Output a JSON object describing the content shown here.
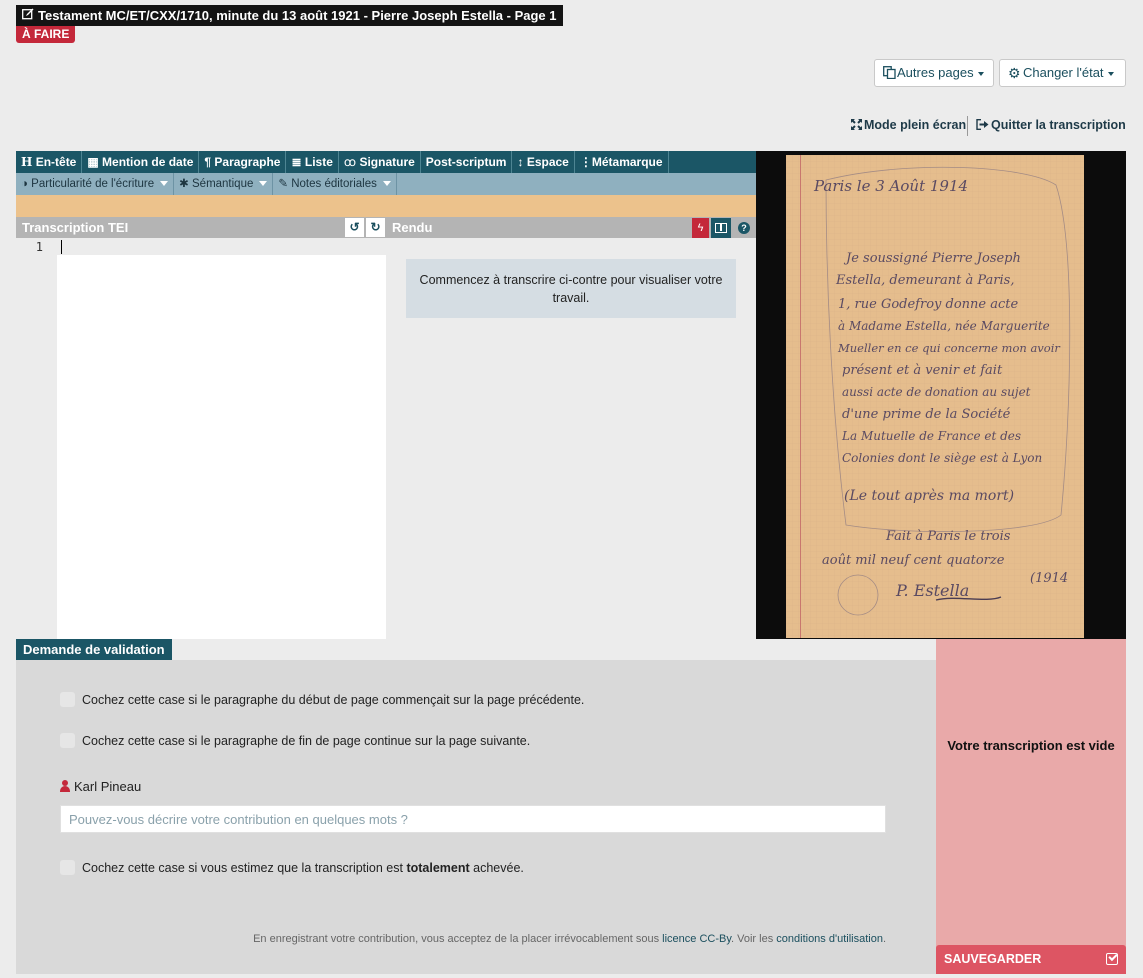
{
  "page": {
    "title": "Testament MC/ET/CXX/1710, minute du 13 août 1921 - Pierre Joseph Estella - Page 1",
    "status": "À FAIRE"
  },
  "actions": {
    "other_pages": "Autres pages",
    "change_state": "Changer l'état",
    "fullscreen": "Mode plein écran",
    "quit": "Quitter la transcription"
  },
  "toolbar_main": [
    {
      "name": "entete",
      "label": "En-tête",
      "icon": "header-icon"
    },
    {
      "name": "date",
      "label": "Mention de date",
      "icon": "calendar-icon"
    },
    {
      "name": "paragraphe",
      "label": "Paragraphe",
      "icon": "pilcrow-icon"
    },
    {
      "name": "liste",
      "label": "Liste",
      "icon": "list-icon"
    },
    {
      "name": "signature",
      "label": "Signature",
      "icon": "signature-icon"
    },
    {
      "name": "postscriptum",
      "label": "Post-scriptum",
      "icon": ""
    },
    {
      "name": "espace",
      "label": "Espace",
      "icon": "vertical-space-icon"
    },
    {
      "name": "metamarque",
      "label": "Métamarque",
      "icon": "vertical-dots-icon"
    }
  ],
  "toolbar_secondary": [
    {
      "name": "ecriture",
      "label": "Particularité de l'écriture",
      "icon": "half-circle-icon"
    },
    {
      "name": "semantique",
      "label": "Sémantique",
      "icon": "bug-icon"
    },
    {
      "name": "notes",
      "label": "Notes éditoriales",
      "icon": "notes-icon"
    }
  ],
  "editor": {
    "title": "Transcription TEI",
    "line_number": "1",
    "undo": "↺",
    "redo": "↻"
  },
  "render": {
    "title": "Rendu",
    "message": "Commencez à transcrire ci-contre pour visualiser votre travail."
  },
  "manuscript": {
    "lines": [
      "Paris le 3 Août 1914",
      "Je soussigné Pierre Joseph",
      "Estella, demeurant à Paris,",
      "1, rue Godefroy donne acte",
      "à Madame Estella, née Marguerite",
      "Mueller en ce qui concerne mon avoir",
      "présent et à venir et fait",
      "aussi acte de donation au sujet",
      "d'une prime de la Société",
      "La Mutuelle de France et des",
      "Colonies dont le siège est à Lyon",
      "(Le tout après ma mort)",
      "Fait à Paris le trois",
      "août mil neuf cent quatorze",
      "(1914",
      "P. Estella"
    ]
  },
  "validation": {
    "title": "Demande de validation",
    "check_prev": "Cochez cette case si le paragraphe du début de page commençait sur la page précédente.",
    "check_next": "Cochez cette case si le paragraphe de fin de page continue sur la page suivante.",
    "user": "Karl Pineau",
    "desc_placeholder": "Pouvez-vous décrire votre contribution en quelques mots ?",
    "check_done_pre": "Cochez cette case si vous estimez que la transcription est ",
    "check_done_bold": "totalement",
    "check_done_post": " achevée.",
    "legal_pre": "En enregistrant votre contribution, vous acceptez de la placer irrévocablement sous ",
    "legal_link1": "licence CC-By",
    "legal_mid": ". Voir les ",
    "legal_link2": "conditions d'utilisation",
    "legal_post": "."
  },
  "side": {
    "message": "Votre transcription est vide",
    "save": "SAUVEGARDER"
  },
  "colors": {
    "brand_dark": "#1b5666",
    "status_red": "#c4283a",
    "save_red": "#dd5563",
    "panel_pink": "#e9a9a9"
  }
}
